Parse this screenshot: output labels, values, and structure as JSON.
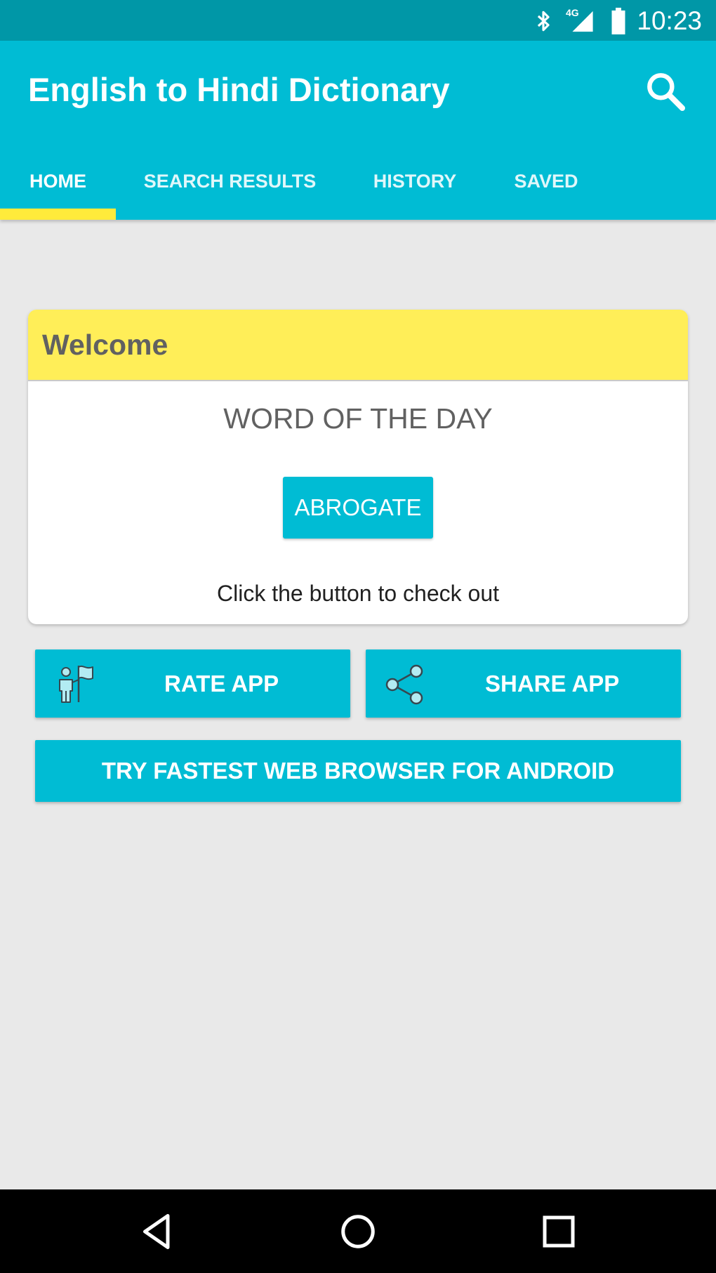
{
  "status_bar": {
    "time": "10:23",
    "network": "4G",
    "icons": [
      "bluetooth-icon",
      "signal-icon",
      "battery-icon"
    ]
  },
  "app_bar": {
    "title": "English to Hindi Dictionary",
    "search_icon": "search-icon",
    "tabs": [
      {
        "label": "HOME",
        "active": true
      },
      {
        "label": "SEARCH RESULTS",
        "active": false
      },
      {
        "label": "HISTORY",
        "active": false
      },
      {
        "label": "SAVED",
        "active": false
      }
    ]
  },
  "welcome_card": {
    "title": "Welcome",
    "word_of_day_label": "WORD OF THE DAY",
    "word": "ABROGATE",
    "hint": "Click the button to check out"
  },
  "actions": {
    "rate_label": "RATE APP",
    "rate_icon": "flag-person-icon",
    "share_label": "SHARE APP",
    "share_icon": "share-icon",
    "browser_label": "TRY FASTEST WEB BROWSER FOR ANDROID"
  },
  "nav_bar": {
    "icons": [
      "back-icon",
      "home-icon",
      "recent-apps-icon"
    ]
  },
  "colors": {
    "primary": "#00bcd4",
    "primary_dark": "#0097a7",
    "accent": "#ffeb3b",
    "card_header": "#ffee58",
    "background": "#e9e9e9"
  }
}
